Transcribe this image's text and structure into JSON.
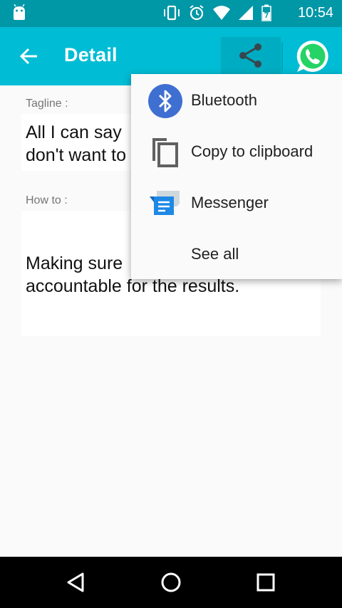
{
  "status_bar": {
    "time": "10:54",
    "icons": [
      "android-icon",
      "vibrate-icon",
      "alarm-icon",
      "wifi-icon",
      "signal-icon",
      "battery-icon"
    ]
  },
  "app_bar": {
    "title": "Detail",
    "back_icon": "arrow-left-icon",
    "share_icon": "share-icon",
    "whatsapp_icon": "whatsapp-icon",
    "color": "#00bcd4"
  },
  "content": {
    "tagline_label": "Tagline :",
    "tagline_lines": [
      "All I can say",
      "don't want to"
    ],
    "howto_label": "How to :",
    "howto_lines": [
      "Making sure",
      "accountable for the results."
    ]
  },
  "share_menu": {
    "items": [
      {
        "label": "Bluetooth",
        "icon": "bluetooth-icon"
      },
      {
        "label": "Copy to clipboard",
        "icon": "copy-icon"
      },
      {
        "label": "Messenger",
        "icon": "messenger-icon"
      },
      {
        "label": "See all",
        "icon": ""
      }
    ]
  },
  "nav_bar": {
    "back": "back-triangle-icon",
    "home": "home-circle-icon",
    "recents": "recents-square-icon"
  }
}
